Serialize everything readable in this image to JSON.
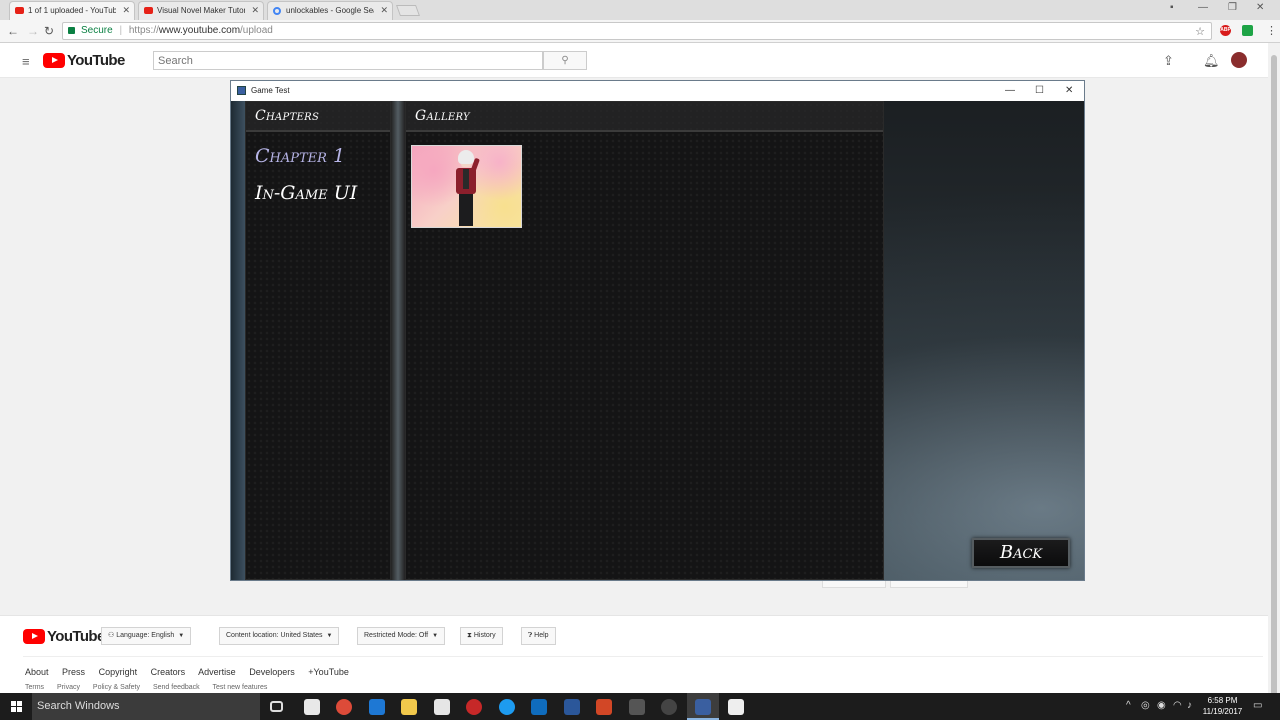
{
  "browser": {
    "tabs": [
      {
        "label": "1 of 1 uploaded - YouTube",
        "active": true
      },
      {
        "label": "Visual Novel Maker Tutorial",
        "active": false
      },
      {
        "label": "unlockables - Google Search",
        "active": false
      }
    ],
    "secure_label": "Secure",
    "url_scheme": "https://",
    "url_host": "www.youtube.com",
    "url_path": "/upload",
    "ext_abp": "ABP"
  },
  "youtube": {
    "logo_text": "YouTube",
    "search_placeholder": "Search"
  },
  "game_window": {
    "title": "Game Test",
    "chapters_header": "Chapters",
    "gallery_header": "Gallery",
    "chapters": [
      "Chapter 1",
      "In-Game UI"
    ],
    "back_label": "Back"
  },
  "footer": {
    "logo_text": "YouTube",
    "language": "Language: English",
    "content_location_label": "Content location:",
    "content_location_value": "United States",
    "restricted_label": "Restricted Mode:",
    "restricted_value": "Off",
    "history": "History",
    "help": "Help",
    "links": [
      "About",
      "Press",
      "Copyright",
      "Creators",
      "Advertise",
      "Developers",
      "+YouTube"
    ],
    "sublinks": [
      "Terms",
      "Privacy",
      "Policy & Safety",
      "Send feedback",
      "Test new features"
    ]
  },
  "taskbar": {
    "search_text": "Search Windows",
    "time": "6:58 PM",
    "date": "11/19/2017"
  },
  "colors": {
    "youtube_red": "#ff0000",
    "chapter_active": "#b6b4e6",
    "secure_green": "#0b8043"
  }
}
